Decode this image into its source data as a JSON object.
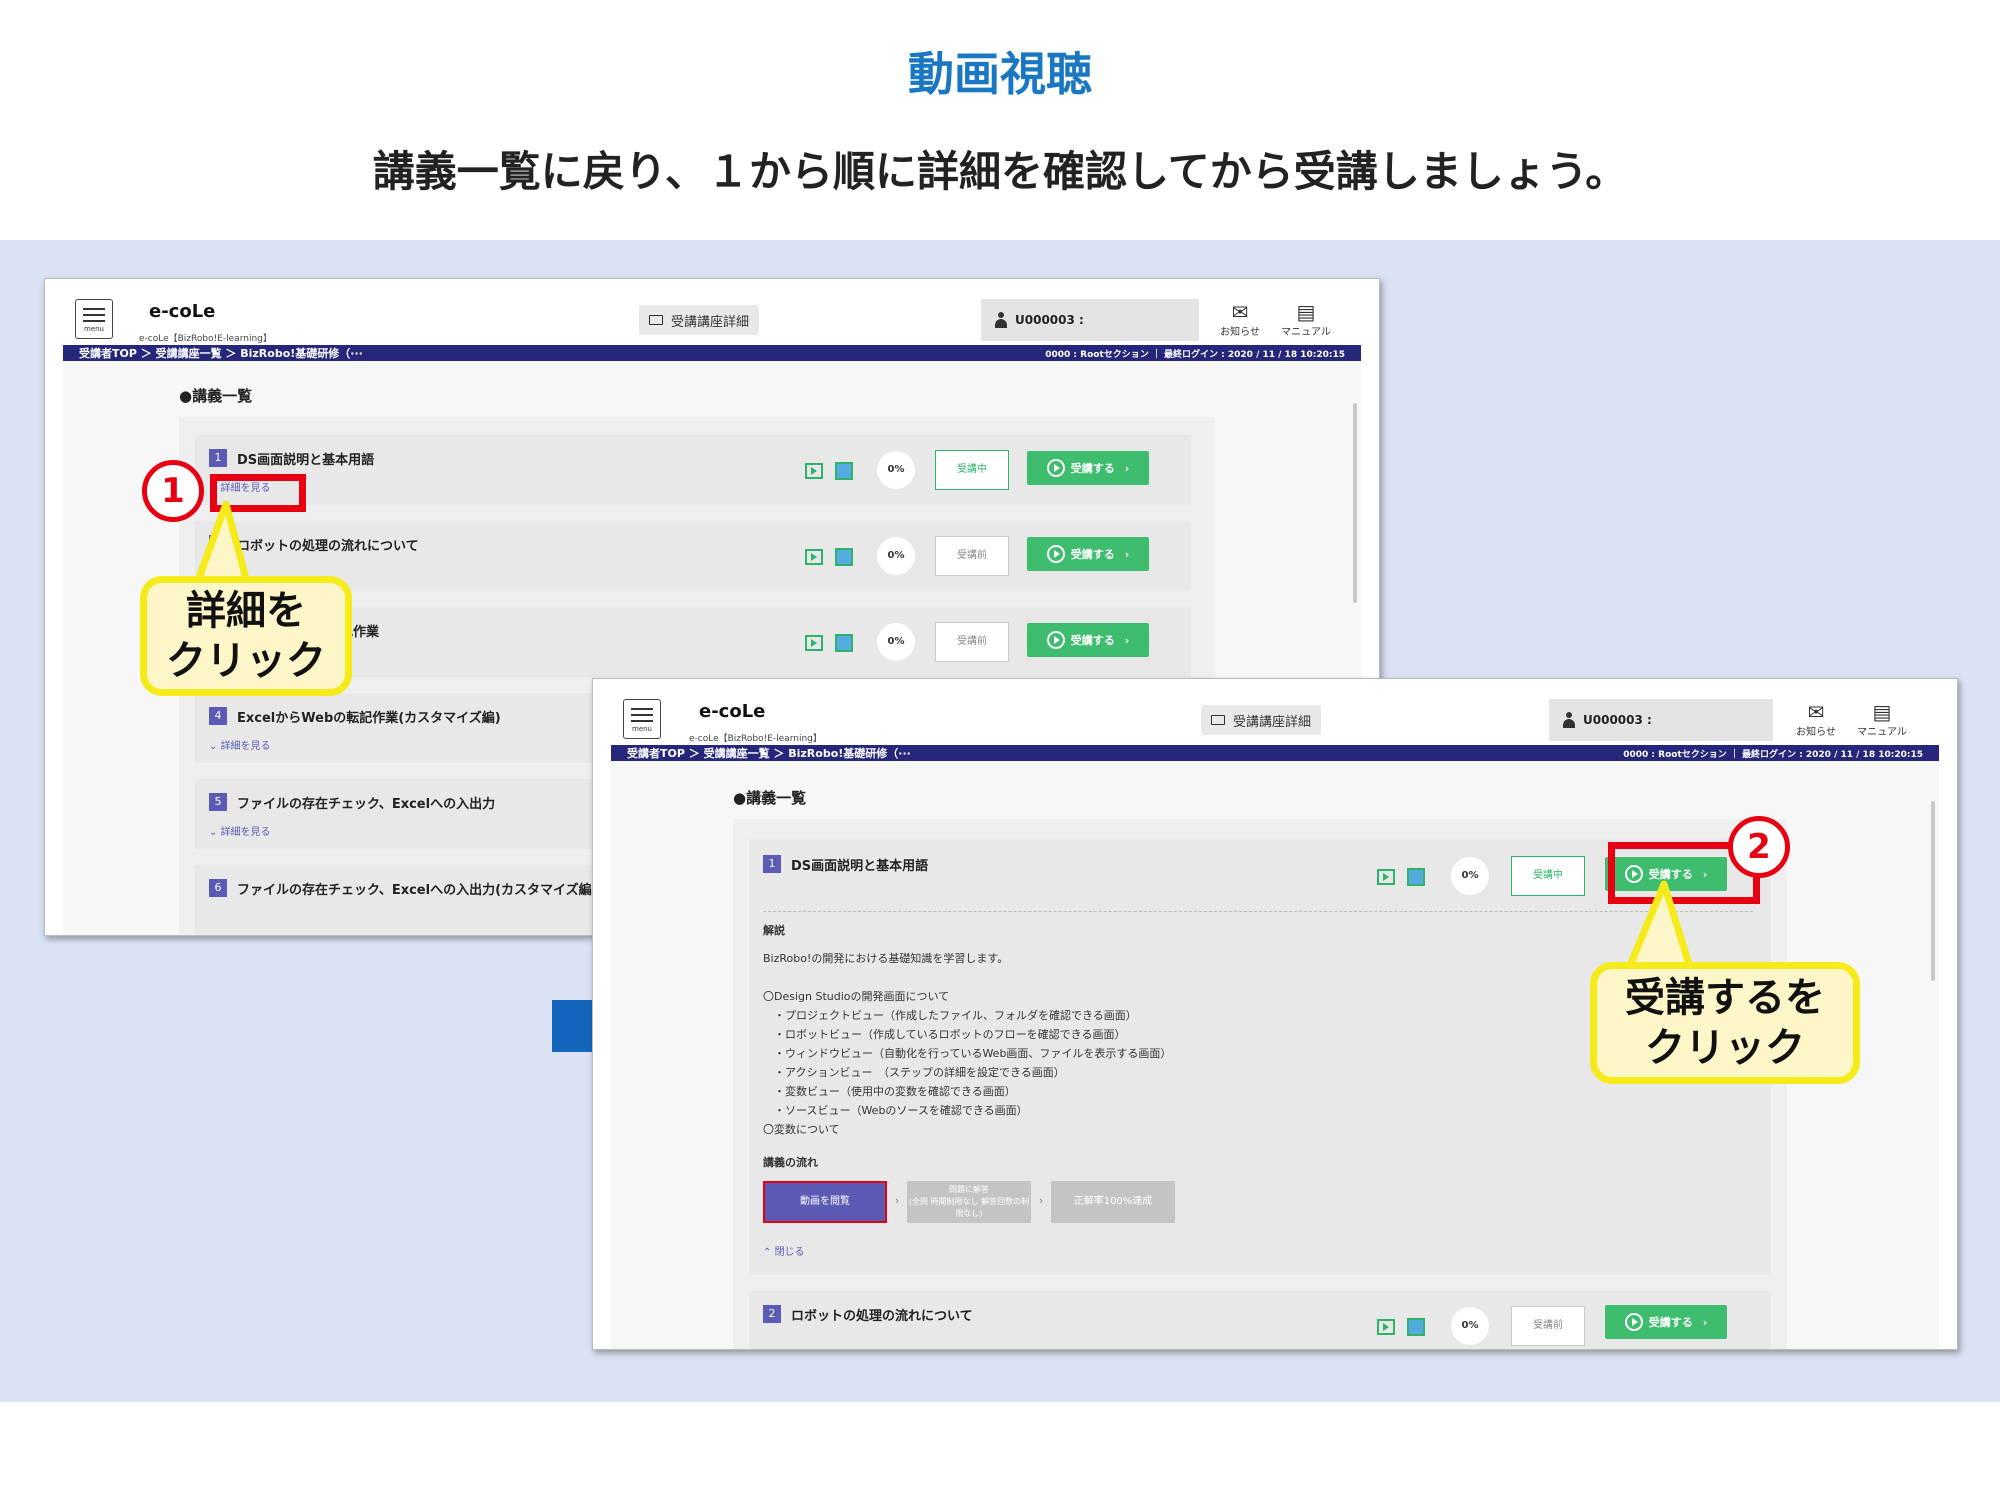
{
  "heading": {
    "title": "動画視聴",
    "subtitle": "講義一覧に戻り、１から順に詳細を確認してから受講しましょう。"
  },
  "app": {
    "menu_label": "menu",
    "logo": "e-coLe",
    "logo_sub": "e-coLe【BizRobo!E-learning】",
    "tab_detail": "受講講座詳細",
    "user": "U000003 :",
    "notice_label": "お知らせ",
    "manual_label": "マニュアル",
    "breadcrumb": "受講者TOP ＞ 受講講座一覧 ＞ BizRobo!基礎研修（···",
    "login_info": "0000 : Rootセクション ｜ 最終ログイン : 2020 / 11 / 18 10:20:15",
    "section_title": "●講義一覧",
    "more_label": "詳細を見る",
    "attend_label": "受講する",
    "close_label": "閉じる"
  },
  "lectures": [
    {
      "num": "1",
      "title": "DS画面説明と基本用語",
      "percent": "0%",
      "status": "受講中"
    },
    {
      "num": "2",
      "title": "ロボットの処理の流れについて",
      "percent": "0%",
      "status": "受講前"
    },
    {
      "num": "3",
      "title": "転記作業",
      "percent": "0%",
      "status": "受講前"
    },
    {
      "num": "4",
      "title": "ExcelからWebの転記作業(カスタマイズ編)"
    },
    {
      "num": "5",
      "title": "ファイルの存在チェック、Excelへの入出力"
    },
    {
      "num": "6",
      "title": "ファイルの存在チェック、Excelへの入出力(カスタマイズ編"
    }
  ],
  "detail": {
    "heading": "解説",
    "intro": "BizRobo!の開発における基礎知識を学習します。",
    "lines": [
      "〇Design Studioの開発画面について",
      "　・プロジェクトビュー（作成したファイル、フォルダを確認できる画面）",
      "　・ロボットビュー（作成しているロボットのフローを確認できる画面）",
      "　・ウィンドウビュー（自動化を行っているWeb画面、ファイルを表示する画面）",
      "　・アクションビュー　（ステップの詳細を設定できる画面）",
      "　・変数ビュー（使用中の変数を確認できる画面）",
      "　・ソースビュー（Webのソースを確認できる画面）",
      "〇変数について"
    ],
    "flow_heading": "講義の流れ",
    "flow_steps": [
      "動画を閲覧",
      "問題に解答\n(全問 時間制限なし 解答回数の制限なし)",
      "正解率100%達成"
    ]
  },
  "annotations": {
    "step1": "1",
    "step2": "2",
    "callout1_line1": "詳細を",
    "callout1_line2": "クリック",
    "callout2_line1": "受講するを",
    "callout2_line2": "クリック"
  },
  "colors": {
    "title_blue": "#1a78c2",
    "band": "#dbe2f3",
    "navbar": "#26267a",
    "green": "#3ebd6e",
    "red": "#e60012",
    "callout_yellow": "#f5ea1a",
    "arrow_blue": "#1466bd"
  }
}
